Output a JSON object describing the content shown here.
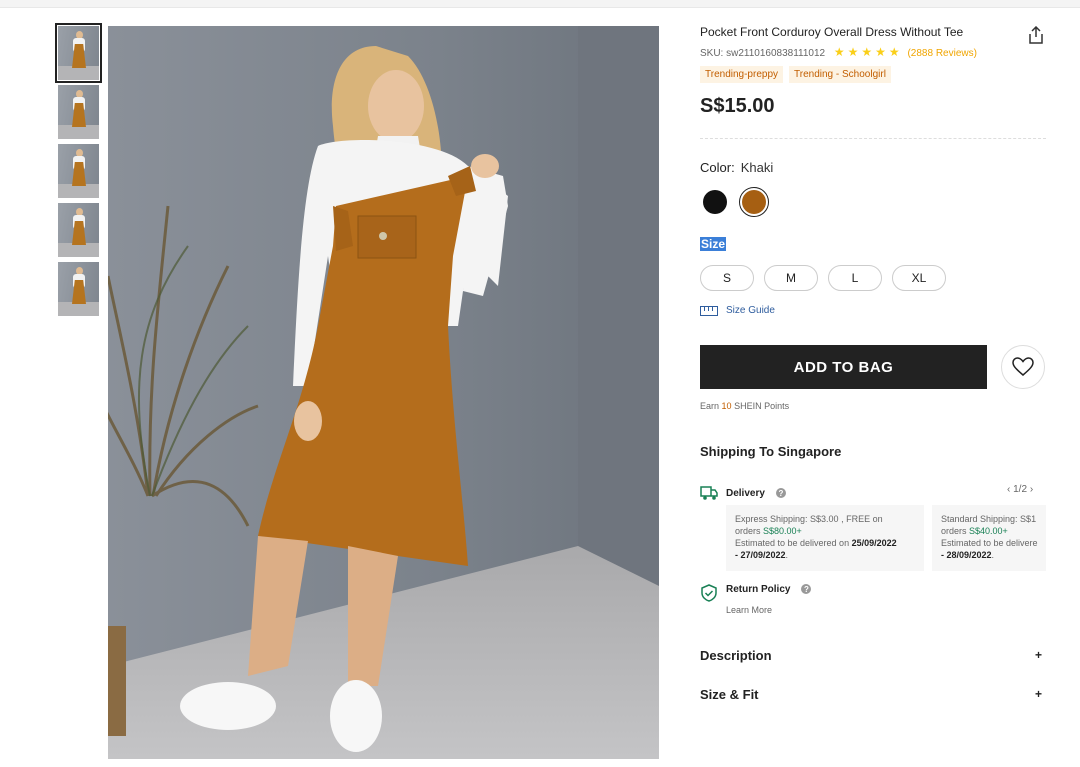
{
  "product": {
    "title": "Pocket Front Corduroy Overall Dress Without Tee",
    "sku": "SKU: sw2110160838111012",
    "stars": "★★★★★",
    "reviews": "(2888 Reviews)",
    "tags": [
      "Trending-preppy",
      "Trending - Schoolgirl"
    ],
    "price": "S$15.00"
  },
  "color": {
    "label": "Color:",
    "value": "Khaki",
    "options": [
      {
        "name": "black",
        "hex": "#111111"
      },
      {
        "name": "khaki",
        "hex": "#a65f12",
        "selected": true
      }
    ]
  },
  "size": {
    "label": "Size",
    "options": [
      "S",
      "M",
      "L",
      "XL"
    ],
    "guide_label": "Size Guide"
  },
  "actions": {
    "add_to_bag": "ADD TO BAG"
  },
  "points": {
    "prefix": "Earn",
    "number": "10",
    "suffix": "SHEIN Points"
  },
  "shipping": {
    "title": "Shipping To Singapore",
    "delivery_label": "Delivery",
    "pager": "1/2",
    "cards": [
      {
        "line1": "Express Shipping: S$3.00 , FREE on",
        "line2_prefix": "orders",
        "line2_value": "S$80.00+",
        "line3": "Estimated to be delivered on",
        "date_start": "25/09/2022",
        "date_end": "- 27/09/2022",
        "date_end_suffix": "."
      },
      {
        "line1": "Standard Shipping: S$1",
        "line2_prefix": "orders",
        "line2_value": "S$40.00+",
        "line3": "Estimated to be delivere",
        "date_end": "- 28/09/2022",
        "date_end_suffix": "."
      }
    ],
    "return_label": "Return Policy",
    "learn_more": "Learn More"
  },
  "accordions": [
    {
      "label": "Description",
      "icon": "+"
    },
    {
      "label": "Size & Fit",
      "icon": "+"
    }
  ],
  "colors": {
    "accent": "#222222",
    "tag_bg": "#fdf3e3",
    "tag_text": "#c25e00",
    "star": "#facf19",
    "green": "#198055",
    "size_highlight": "#3b7fd8"
  },
  "icons": [
    "share-icon",
    "star-icon",
    "ruler-icon",
    "heart-icon",
    "truck-icon",
    "shield-check-icon",
    "question-icon",
    "chevron-left-icon",
    "chevron-right-icon",
    "plus-icon"
  ]
}
